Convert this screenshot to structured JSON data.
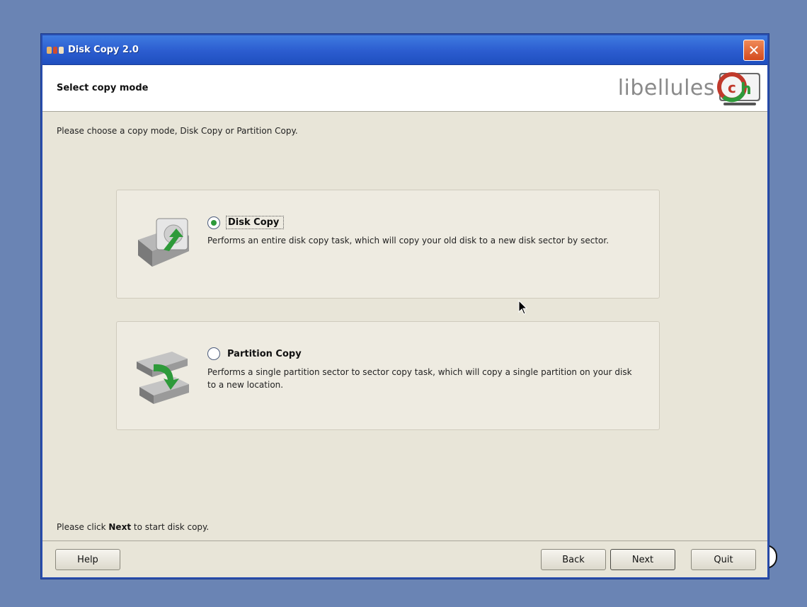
{
  "window": {
    "title": "Disk Copy 2.0",
    "close_glyph": "✕"
  },
  "header": {
    "title": "Select copy mode",
    "logo_text": "libellules"
  },
  "instruction": "Please choose a copy mode, Disk Copy or Partition Copy.",
  "options": [
    {
      "label": "Disk Copy",
      "description": "Performs an entire disk copy task, which will copy your old disk to a new disk sector by sector.",
      "selected": true,
      "icon": "disk-copy-icon"
    },
    {
      "label": "Partition Copy",
      "description": "Performs a single partition sector to sector copy task, which will copy a single partition on your disk to a new location.",
      "selected": false,
      "icon": "partition-copy-icon"
    }
  ],
  "footer": {
    "note_prefix": "Please click ",
    "note_bold": "Next",
    "note_suffix": " to start disk copy."
  },
  "buttons": {
    "help": "Help",
    "back": "Back",
    "next": "Next",
    "quit": "Quit"
  },
  "colors": {
    "titlebar": "#2b5ccf",
    "close": "#d44a1e",
    "selected_radio": "#2e9a3a",
    "desktop": "#6a84b4"
  }
}
